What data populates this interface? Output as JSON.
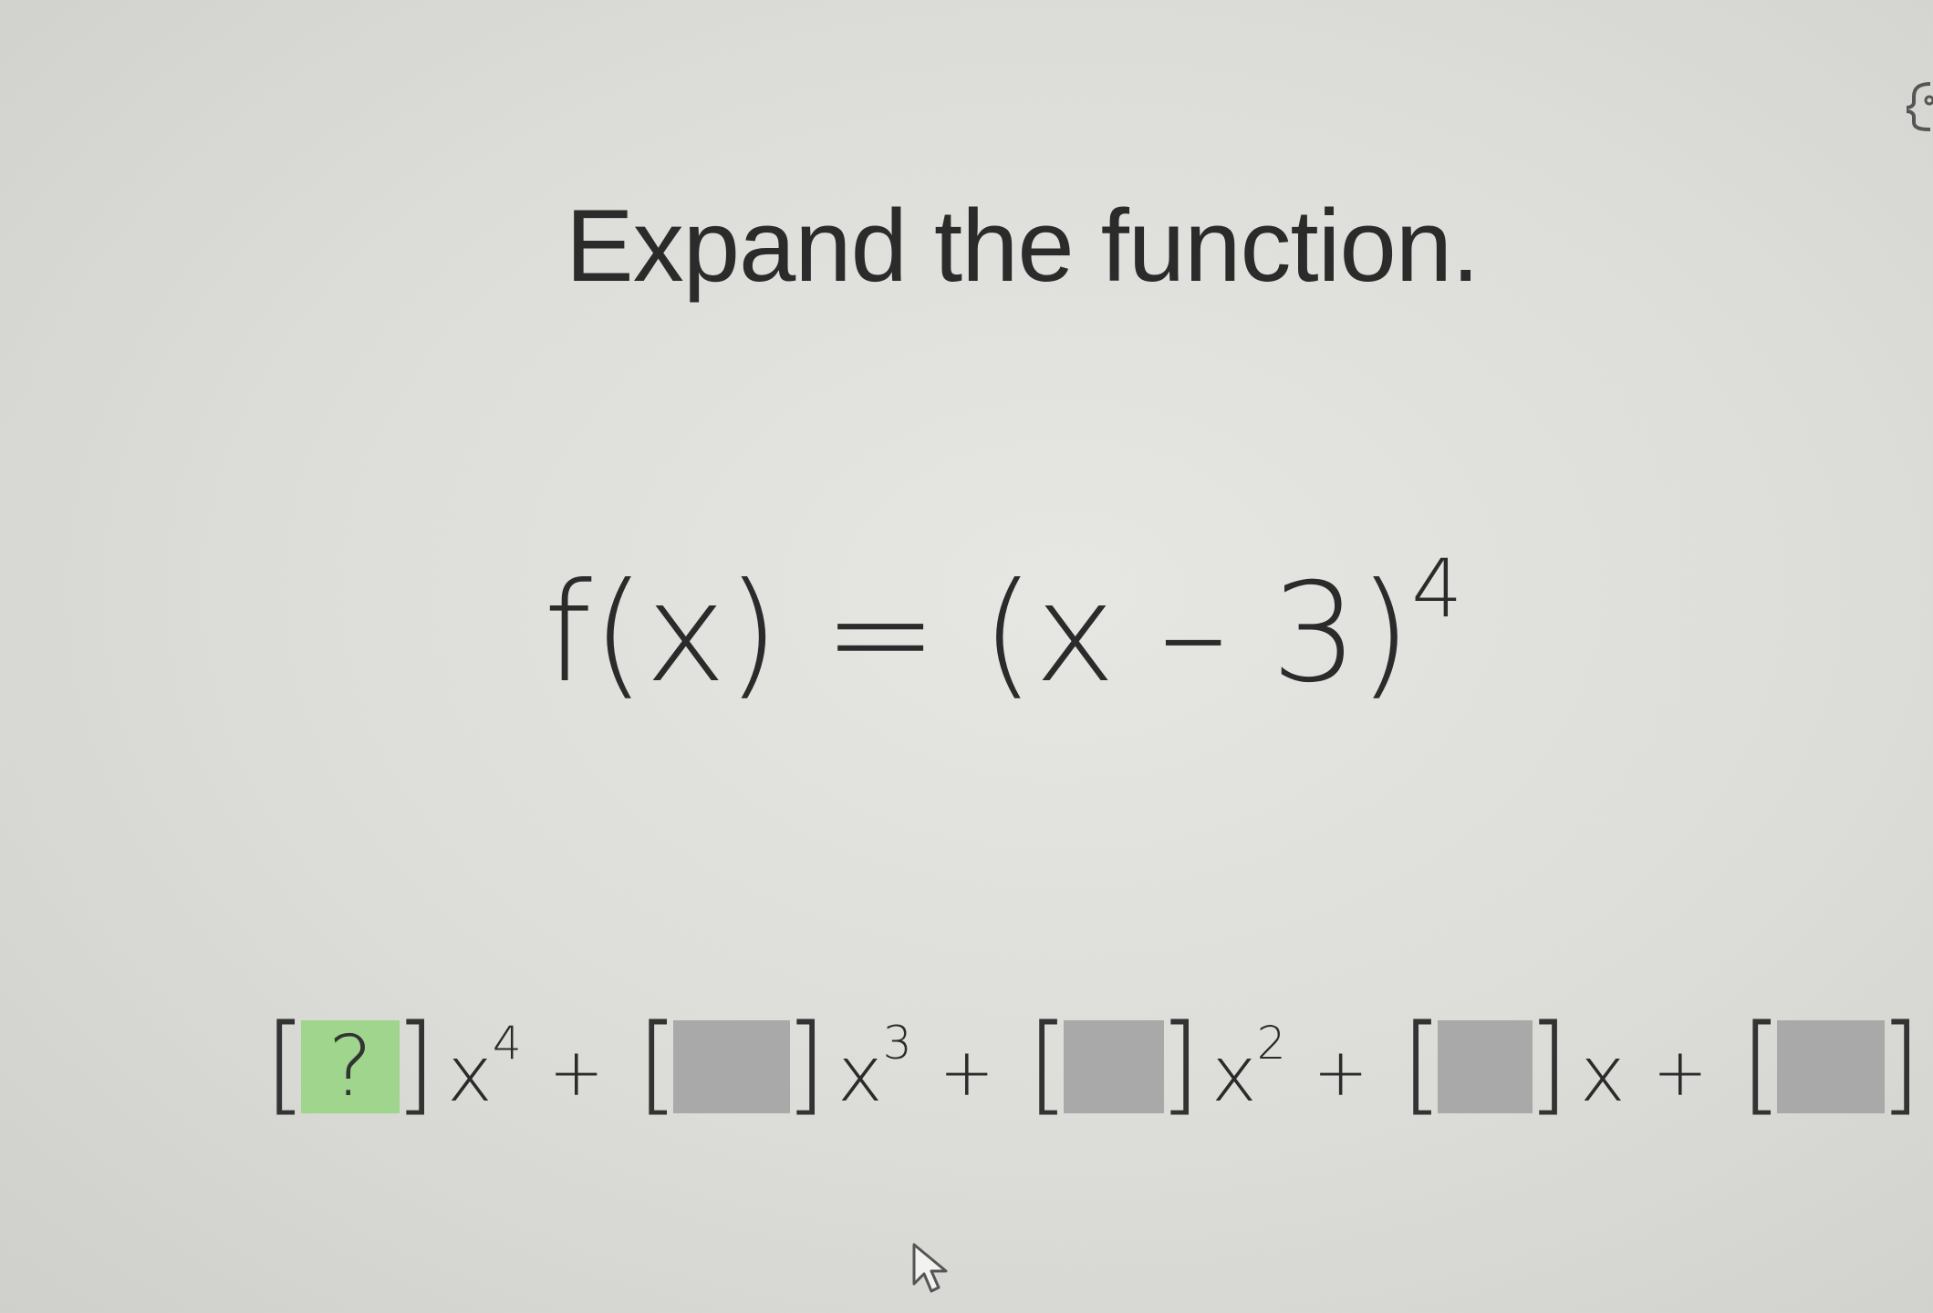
{
  "prompt": {
    "title": "Expand the function."
  },
  "function": {
    "lhs": "f(x) = (x – 3)",
    "exponent": "4"
  },
  "answer": {
    "terms": [
      {
        "value": "?",
        "variable": "x",
        "exponent": "4"
      },
      {
        "value": "",
        "variable": "x",
        "exponent": "3"
      },
      {
        "value": "",
        "variable": "x",
        "exponent": "2"
      },
      {
        "value": "",
        "variable": "x",
        "exponent": ""
      },
      {
        "value": "",
        "variable": "",
        "exponent": ""
      }
    ],
    "operator": "+"
  },
  "colors": {
    "active_box": "#9fd58d",
    "inactive_box": "#a9a9a9"
  }
}
